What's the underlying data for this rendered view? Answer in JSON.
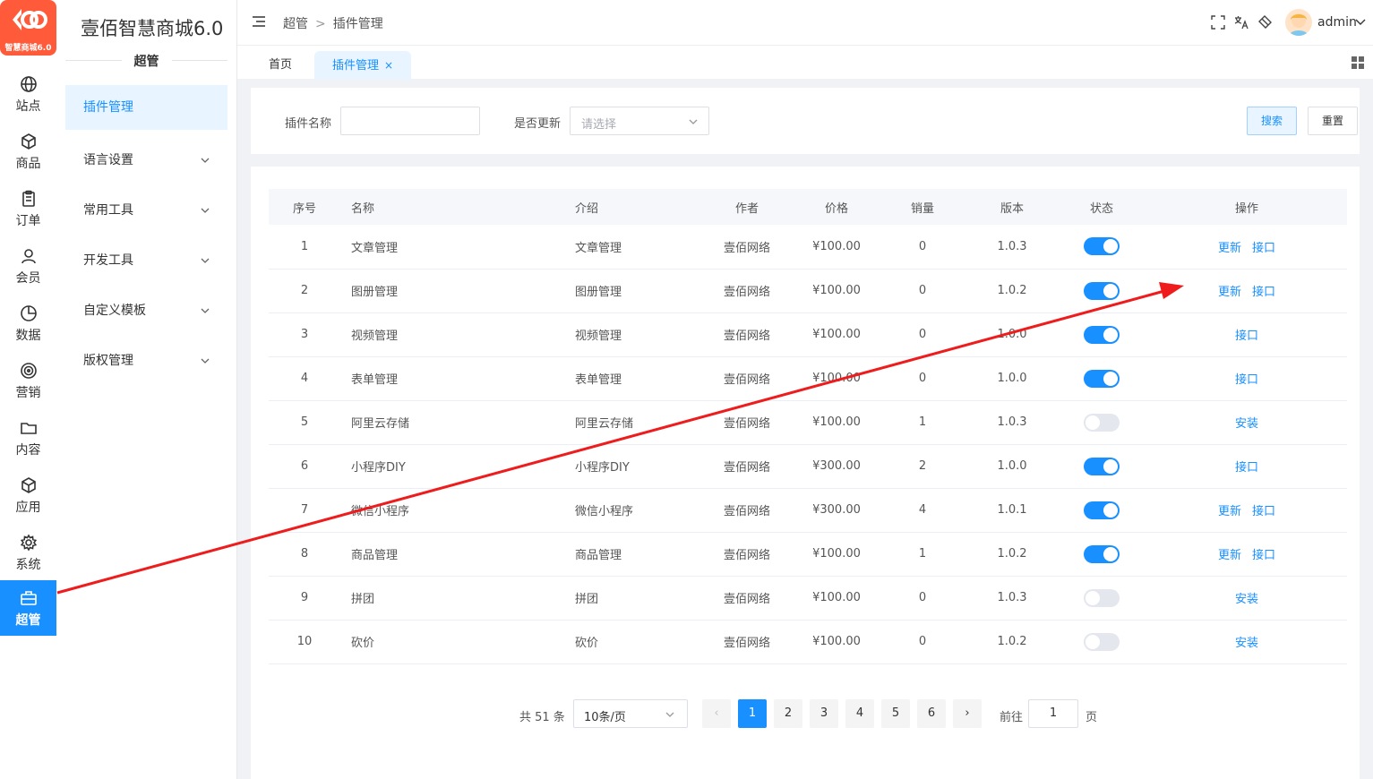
{
  "logo": {
    "tag": "智慧商城6.0"
  },
  "rail": [
    {
      "label": "站点",
      "icon": "globe-icon"
    },
    {
      "label": "商品",
      "icon": "box-icon"
    },
    {
      "label": "订单",
      "icon": "clipboard-icon"
    },
    {
      "label": "会员",
      "icon": "user-icon"
    },
    {
      "label": "数据",
      "icon": "pie-chart-icon"
    },
    {
      "label": "营销",
      "icon": "target-icon"
    },
    {
      "label": "内容",
      "icon": "folder-icon"
    },
    {
      "label": "应用",
      "icon": "cube-icon"
    },
    {
      "label": "系统",
      "icon": "gear-icon"
    },
    {
      "label": "超管",
      "icon": "briefcase-icon"
    }
  ],
  "sidebar": {
    "brand": "壹佰智慧商城6.0",
    "section": "超管",
    "items": [
      "插件管理",
      "语言设置",
      "常用工具",
      "开发工具",
      "自定义模板",
      "版权管理"
    ]
  },
  "header": {
    "crumb_root": "超管",
    "crumb_sep": ">",
    "crumb_current": "插件管理",
    "username": "admin"
  },
  "tabs": {
    "home": "首页",
    "current": "插件管理",
    "close": "×"
  },
  "search": {
    "name_label": "插件名称",
    "name_value": "",
    "update_label": "是否更新",
    "update_placeholder": "请选择",
    "search_btn": "搜索",
    "reset_btn": "重置"
  },
  "table": {
    "headers": [
      "序号",
      "名称",
      "介绍",
      "作者",
      "价格",
      "销量",
      "版本",
      "状态",
      "操作"
    ],
    "rows": [
      {
        "idx": "1",
        "name": "文章管理",
        "desc": "文章管理",
        "author": "壹佰网络",
        "price": "¥100.00",
        "sales": "0",
        "version": "1.0.3",
        "enabled": true,
        "ops": [
          "更新",
          "接口"
        ]
      },
      {
        "idx": "2",
        "name": "图册管理",
        "desc": "图册管理",
        "author": "壹佰网络",
        "price": "¥100.00",
        "sales": "0",
        "version": "1.0.2",
        "enabled": true,
        "ops": [
          "更新",
          "接口"
        ]
      },
      {
        "idx": "3",
        "name": "视频管理",
        "desc": "视频管理",
        "author": "壹佰网络",
        "price": "¥100.00",
        "sales": "0",
        "version": "1.0.0",
        "enabled": true,
        "ops": [
          "接口"
        ]
      },
      {
        "idx": "4",
        "name": "表单管理",
        "desc": "表单管理",
        "author": "壹佰网络",
        "price": "¥100.00",
        "sales": "0",
        "version": "1.0.0",
        "enabled": true,
        "ops": [
          "接口"
        ]
      },
      {
        "idx": "5",
        "name": "阿里云存储",
        "desc": "阿里云存储",
        "author": "壹佰网络",
        "price": "¥100.00",
        "sales": "1",
        "version": "1.0.3",
        "enabled": false,
        "ops": [
          "安装"
        ]
      },
      {
        "idx": "6",
        "name": "小程序DIY",
        "desc": "小程序DIY",
        "author": "壹佰网络",
        "price": "¥300.00",
        "sales": "2",
        "version": "1.0.0",
        "enabled": true,
        "ops": [
          "接口"
        ]
      },
      {
        "idx": "7",
        "name": "微信小程序",
        "desc": "微信小程序",
        "author": "壹佰网络",
        "price": "¥300.00",
        "sales": "4",
        "version": "1.0.1",
        "enabled": true,
        "ops": [
          "更新",
          "接口"
        ]
      },
      {
        "idx": "8",
        "name": "商品管理",
        "desc": "商品管理",
        "author": "壹佰网络",
        "price": "¥100.00",
        "sales": "1",
        "version": "1.0.2",
        "enabled": true,
        "ops": [
          "更新",
          "接口"
        ]
      },
      {
        "idx": "9",
        "name": "拼团",
        "desc": "拼团",
        "author": "壹佰网络",
        "price": "¥100.00",
        "sales": "0",
        "version": "1.0.3",
        "enabled": false,
        "ops": [
          "安装"
        ]
      },
      {
        "idx": "10",
        "name": "砍价",
        "desc": "砍价",
        "author": "壹佰网络",
        "price": "¥100.00",
        "sales": "0",
        "version": "1.0.2",
        "enabled": false,
        "ops": [
          "安装"
        ]
      }
    ]
  },
  "pagination": {
    "total": "共 51 条",
    "page_size": "10条/页",
    "pages": [
      "1",
      "2",
      "3",
      "4",
      "5",
      "6"
    ],
    "current": 1,
    "goto_label": "前往",
    "goto_value": "1",
    "goto_unit": "页"
  },
  "colors": {
    "accent": "#1890ff",
    "logo": "#ff5b3a",
    "arrow": "#ee1c1c"
  }
}
